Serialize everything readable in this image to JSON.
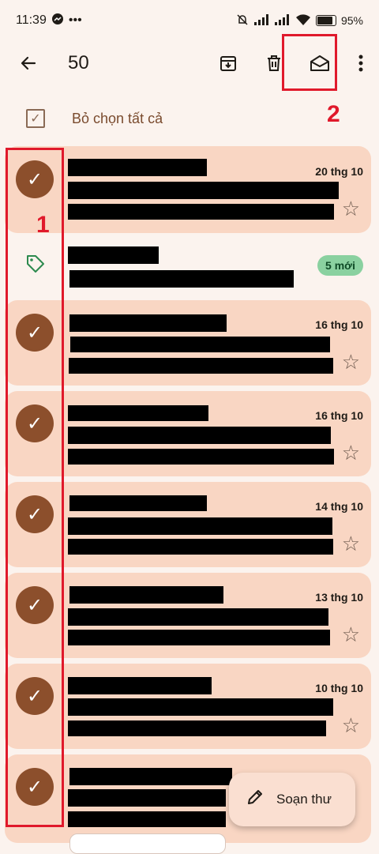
{
  "status": {
    "time": "11:39",
    "battery": "95%"
  },
  "toolbar": {
    "selected_count": "50"
  },
  "select_all": {
    "label": "Bỏ chọn tất cả"
  },
  "annotations": {
    "one": "1",
    "two": "2"
  },
  "rows": [
    {
      "date": "20 thg 10"
    },
    {
      "badge": "5 mới"
    },
    {
      "date": "16 thg 10"
    },
    {
      "date": "16 thg 10"
    },
    {
      "date": "14 thg 10"
    },
    {
      "date": "13 thg 10"
    },
    {
      "date": "10 thg 10"
    }
  ],
  "compose": {
    "label": "Soạn thư"
  },
  "colors": {
    "accent_red": "#e0192b",
    "row_bg": "#f9d6c3",
    "avatar": "#8c4f2c",
    "badge": "#8ad1a0"
  }
}
